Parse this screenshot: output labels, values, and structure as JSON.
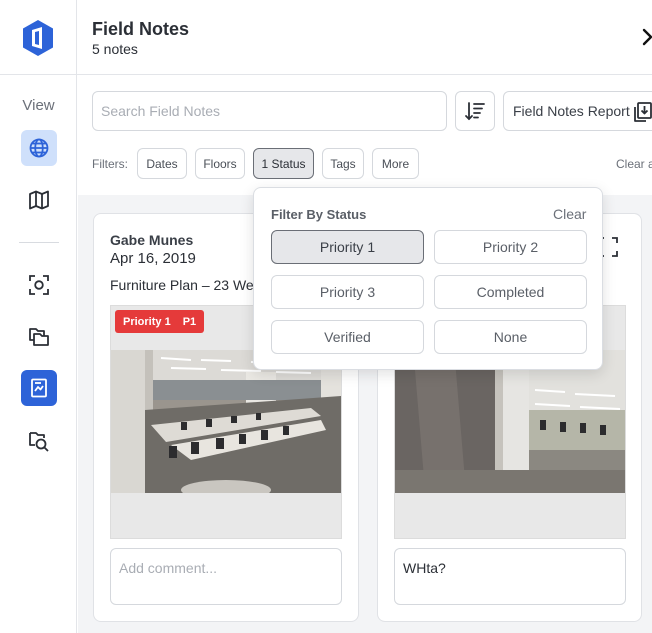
{
  "header": {
    "title": "Field Notes",
    "subtitle": "5 notes"
  },
  "rail": {
    "view_label": "View",
    "icons": [
      "globe-icon",
      "map-icon",
      "scan-icon",
      "folders-icon",
      "field-notes-icon",
      "search-document-icon"
    ]
  },
  "search": {
    "placeholder": "Search Field Notes"
  },
  "report_button": {
    "label": "Field Notes Report"
  },
  "filters": {
    "label": "Filters:",
    "chips": [
      "Dates",
      "Floors",
      "1 Status",
      "Tags",
      "More"
    ],
    "clear_label": "Clear a"
  },
  "status_dropdown": {
    "title": "Filter By Status",
    "clear_label": "Clear",
    "options": [
      "Priority 1",
      "Priority 2",
      "Priority 3",
      "Completed",
      "Verified",
      "None"
    ],
    "selected": "Priority 1"
  },
  "notes": [
    {
      "author": "Gabe Munes",
      "date": "Apr 16, 2019",
      "plan": "Furniture Plan – 23 We",
      "badge_label": "Priority 1",
      "badge_code": "P1",
      "comment_placeholder": "Add comment..."
    },
    {
      "comment": "WHta?"
    }
  ],
  "colors": {
    "accent": "#2d63d8",
    "accent_light": "#cfe0fb",
    "priority_red": "#e53a3a"
  }
}
